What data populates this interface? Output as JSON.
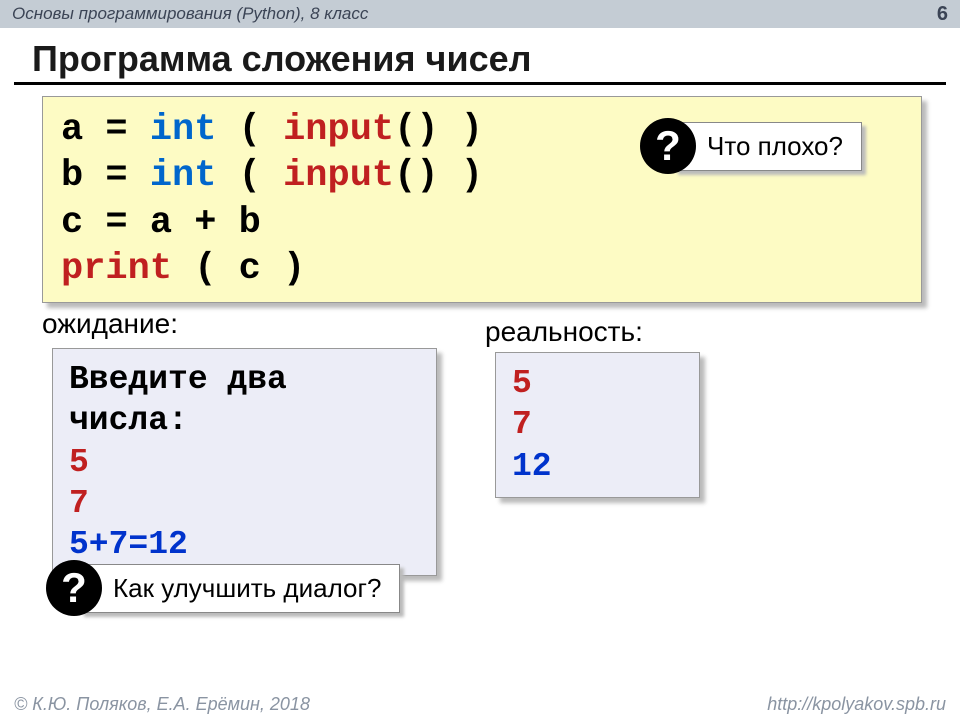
{
  "header": {
    "course": "Основы программирования (Python), 8 класс",
    "page": "6"
  },
  "title": "Программа сложения чисел",
  "code": {
    "l1a": "a = ",
    "l1b": "int",
    "l1c": " ( ",
    "l1d": "input",
    "l1e": "() )",
    "l2a": "b = ",
    "l2b": "int",
    "l2c": " ( ",
    "l2d": "input",
    "l2e": "() )",
    "l3": "c = a + b",
    "l4a": "print",
    "l4b": " ( c )"
  },
  "labels": {
    "expect": "ожидание:",
    "real": "реальность:"
  },
  "expect": {
    "prompt1": "Введите два",
    "prompt2": "числа:",
    "in1": "5",
    "in2": "7",
    "res": "5+7=12"
  },
  "real": {
    "in1": "5",
    "in2": "7",
    "res": "12"
  },
  "callout1": {
    "mark": "?",
    "text": "Что плохо?"
  },
  "callout2": {
    "mark": "?",
    "text": "Как улучшить диалог?"
  },
  "footer": {
    "copyright": "© К.Ю. Поляков, Е.А. Ерёмин, 2018",
    "url": "http://kpolyakov.spb.ru"
  }
}
